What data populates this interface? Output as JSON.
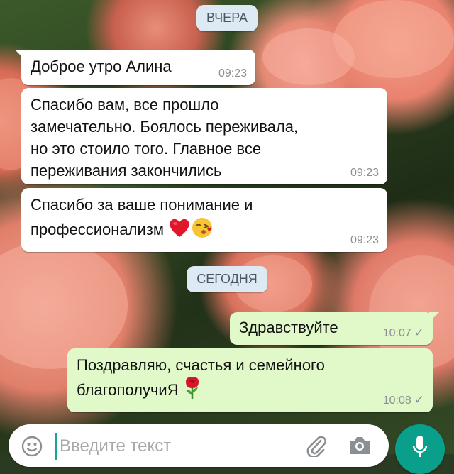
{
  "date_chips": {
    "yesterday": "ВЧЕРА",
    "today": "СЕГОДНЯ"
  },
  "messages": [
    {
      "direction": "incoming",
      "text": "Доброе утро Алина",
      "time": "09:23"
    },
    {
      "direction": "incoming",
      "text": "Спасибо вам, все прошло\nзамечательно. Боялось переживала,\nно это стоило того. Главное все\nпереживания закончились",
      "time": "09:23"
    },
    {
      "direction": "incoming",
      "text": "Спасибо за ваше понимание и\nпрофессионализм",
      "emoji": [
        "red-heart",
        "face-blowing-kiss"
      ],
      "time": "09:23"
    },
    {
      "direction": "outgoing",
      "text": "Здравствуйте",
      "time": "10:07",
      "status": "✓"
    },
    {
      "direction": "outgoing",
      "text": "Поздравляю, счастья и семейного\nблагополучиЯ",
      "emoji": [
        "rose"
      ],
      "time": "10:08",
      "status": "✓"
    }
  ],
  "composer": {
    "placeholder": "Введите текст",
    "icons": [
      "smiley-icon",
      "paperclip-icon",
      "camera-icon",
      "microphone-icon"
    ]
  },
  "colors": {
    "incoming_bubble": "#ffffff",
    "outgoing_bubble": "#e1f8c9",
    "date_chip": "#dde9f3",
    "accent": "#0a9f8a"
  }
}
